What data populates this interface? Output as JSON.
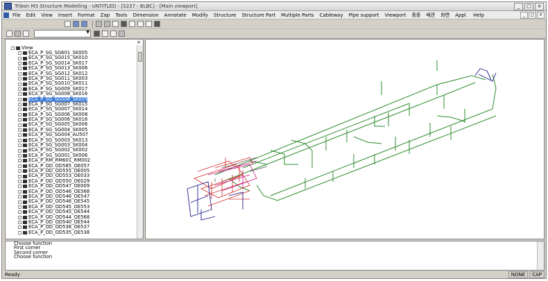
{
  "window": {
    "title": "Tribon M3 Structure Modelling - UNTITLED - [S237 - BLBC] - [Main viewport]"
  },
  "menu": [
    "File",
    "Edit",
    "View",
    "Insert",
    "Format",
    "Zap",
    "Tools",
    "Dimension",
    "Annotate",
    "Modify",
    "Structure",
    "Structure Part",
    "Multiple Parts",
    "Cableway",
    "Pipe support",
    "Viewport",
    "종종",
    "배관",
    "화면",
    "Appl.",
    "Help"
  ],
  "tree": {
    "root": "View",
    "items": [
      "ECA_P_SG_SG601_SK005",
      "ECA_P_SG_SG015_SK010",
      "ECA_P_SG_SG014_SK017",
      "ECA_P_SG_SG013_SK006",
      "ECA_P_SG_SG012_SK012",
      "ECA_P_SG_SG011_SK003",
      "ECA_P_SG_SG010_SK011",
      "ECA_P_SG_SG009_SK017",
      "ECA_P_SG_SG008_SK016",
      "ECA_P_SG_SG008_SK005",
      "ECA_P_SG_SG007_SK015",
      "ECA_P_SG_SG007_SK014",
      "ECA_P_SG_SG006_SK008",
      "ECA_P_SG_SG006_SK016",
      "ECA_P_SG_SG005_SK006",
      "ECA_P_SG_SG004_SK005",
      "ECA_P_SG_SG004_AU507",
      "ECA_P_SG_SG003_SK013",
      "ECA_P_SG_SG003_SK004",
      "ECA_P_SG_SG002_SK002",
      "ECA_P_SG_SG001_SK006",
      "ECA_P_RM_RM601_RM002",
      "ECA_P_OD_OD585_OE057",
      "ECA_P_OD_OD555_OE005",
      "ECA_P_OD_OD553_OE033",
      "ECA_P_OD_OD550_OE029",
      "ECA_P_OD_OD547_OE009",
      "ECA_P_OD_OD546_OE568",
      "ECA_P_OD_OD546_OE547",
      "ECA_P_OD_OD546_OE545",
      "ECA_P_OD_OD545_OE553",
      "ECA_P_OD_OD545_OE544",
      "ECA_P_OD_OD544_OE568",
      "ECA_P_OD_OD540_OE544",
      "ECA_P_OD_OD536_OE537",
      "ECA_P_OD_OD535_OE538"
    ],
    "selected_index": 9
  },
  "command_log": [
    "Choose function",
    "First corner",
    "Second corner",
    "Choose function"
  ],
  "status": {
    "ready": "Ready",
    "mode1": "NONE",
    "mode2": "CAP"
  },
  "colors": {
    "pipe_green": "#2e8b2e",
    "pipe_red": "#d12a2a",
    "pipe_blue": "#1a1a8c",
    "selection": "#3b7bd6"
  }
}
